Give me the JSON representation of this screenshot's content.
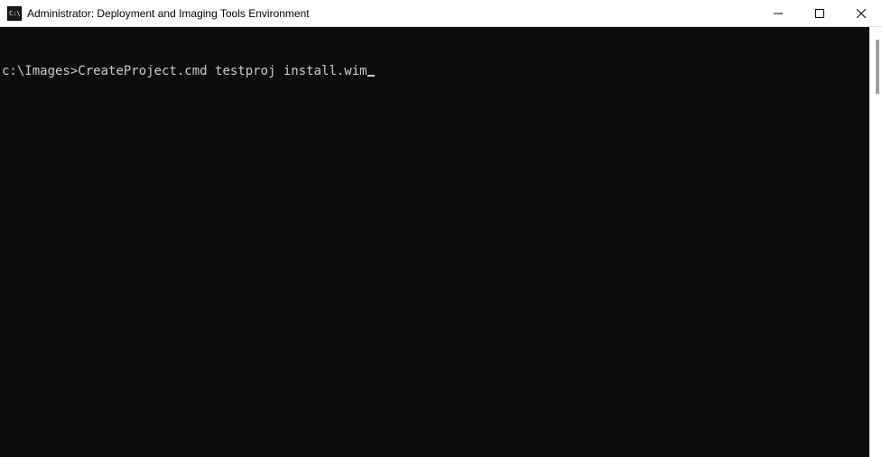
{
  "window": {
    "title": "Administrator: Deployment and Imaging Tools Environment"
  },
  "terminal": {
    "prompt": "c:\\Images>",
    "command": "CreateProject.cmd testproj install.wim"
  }
}
